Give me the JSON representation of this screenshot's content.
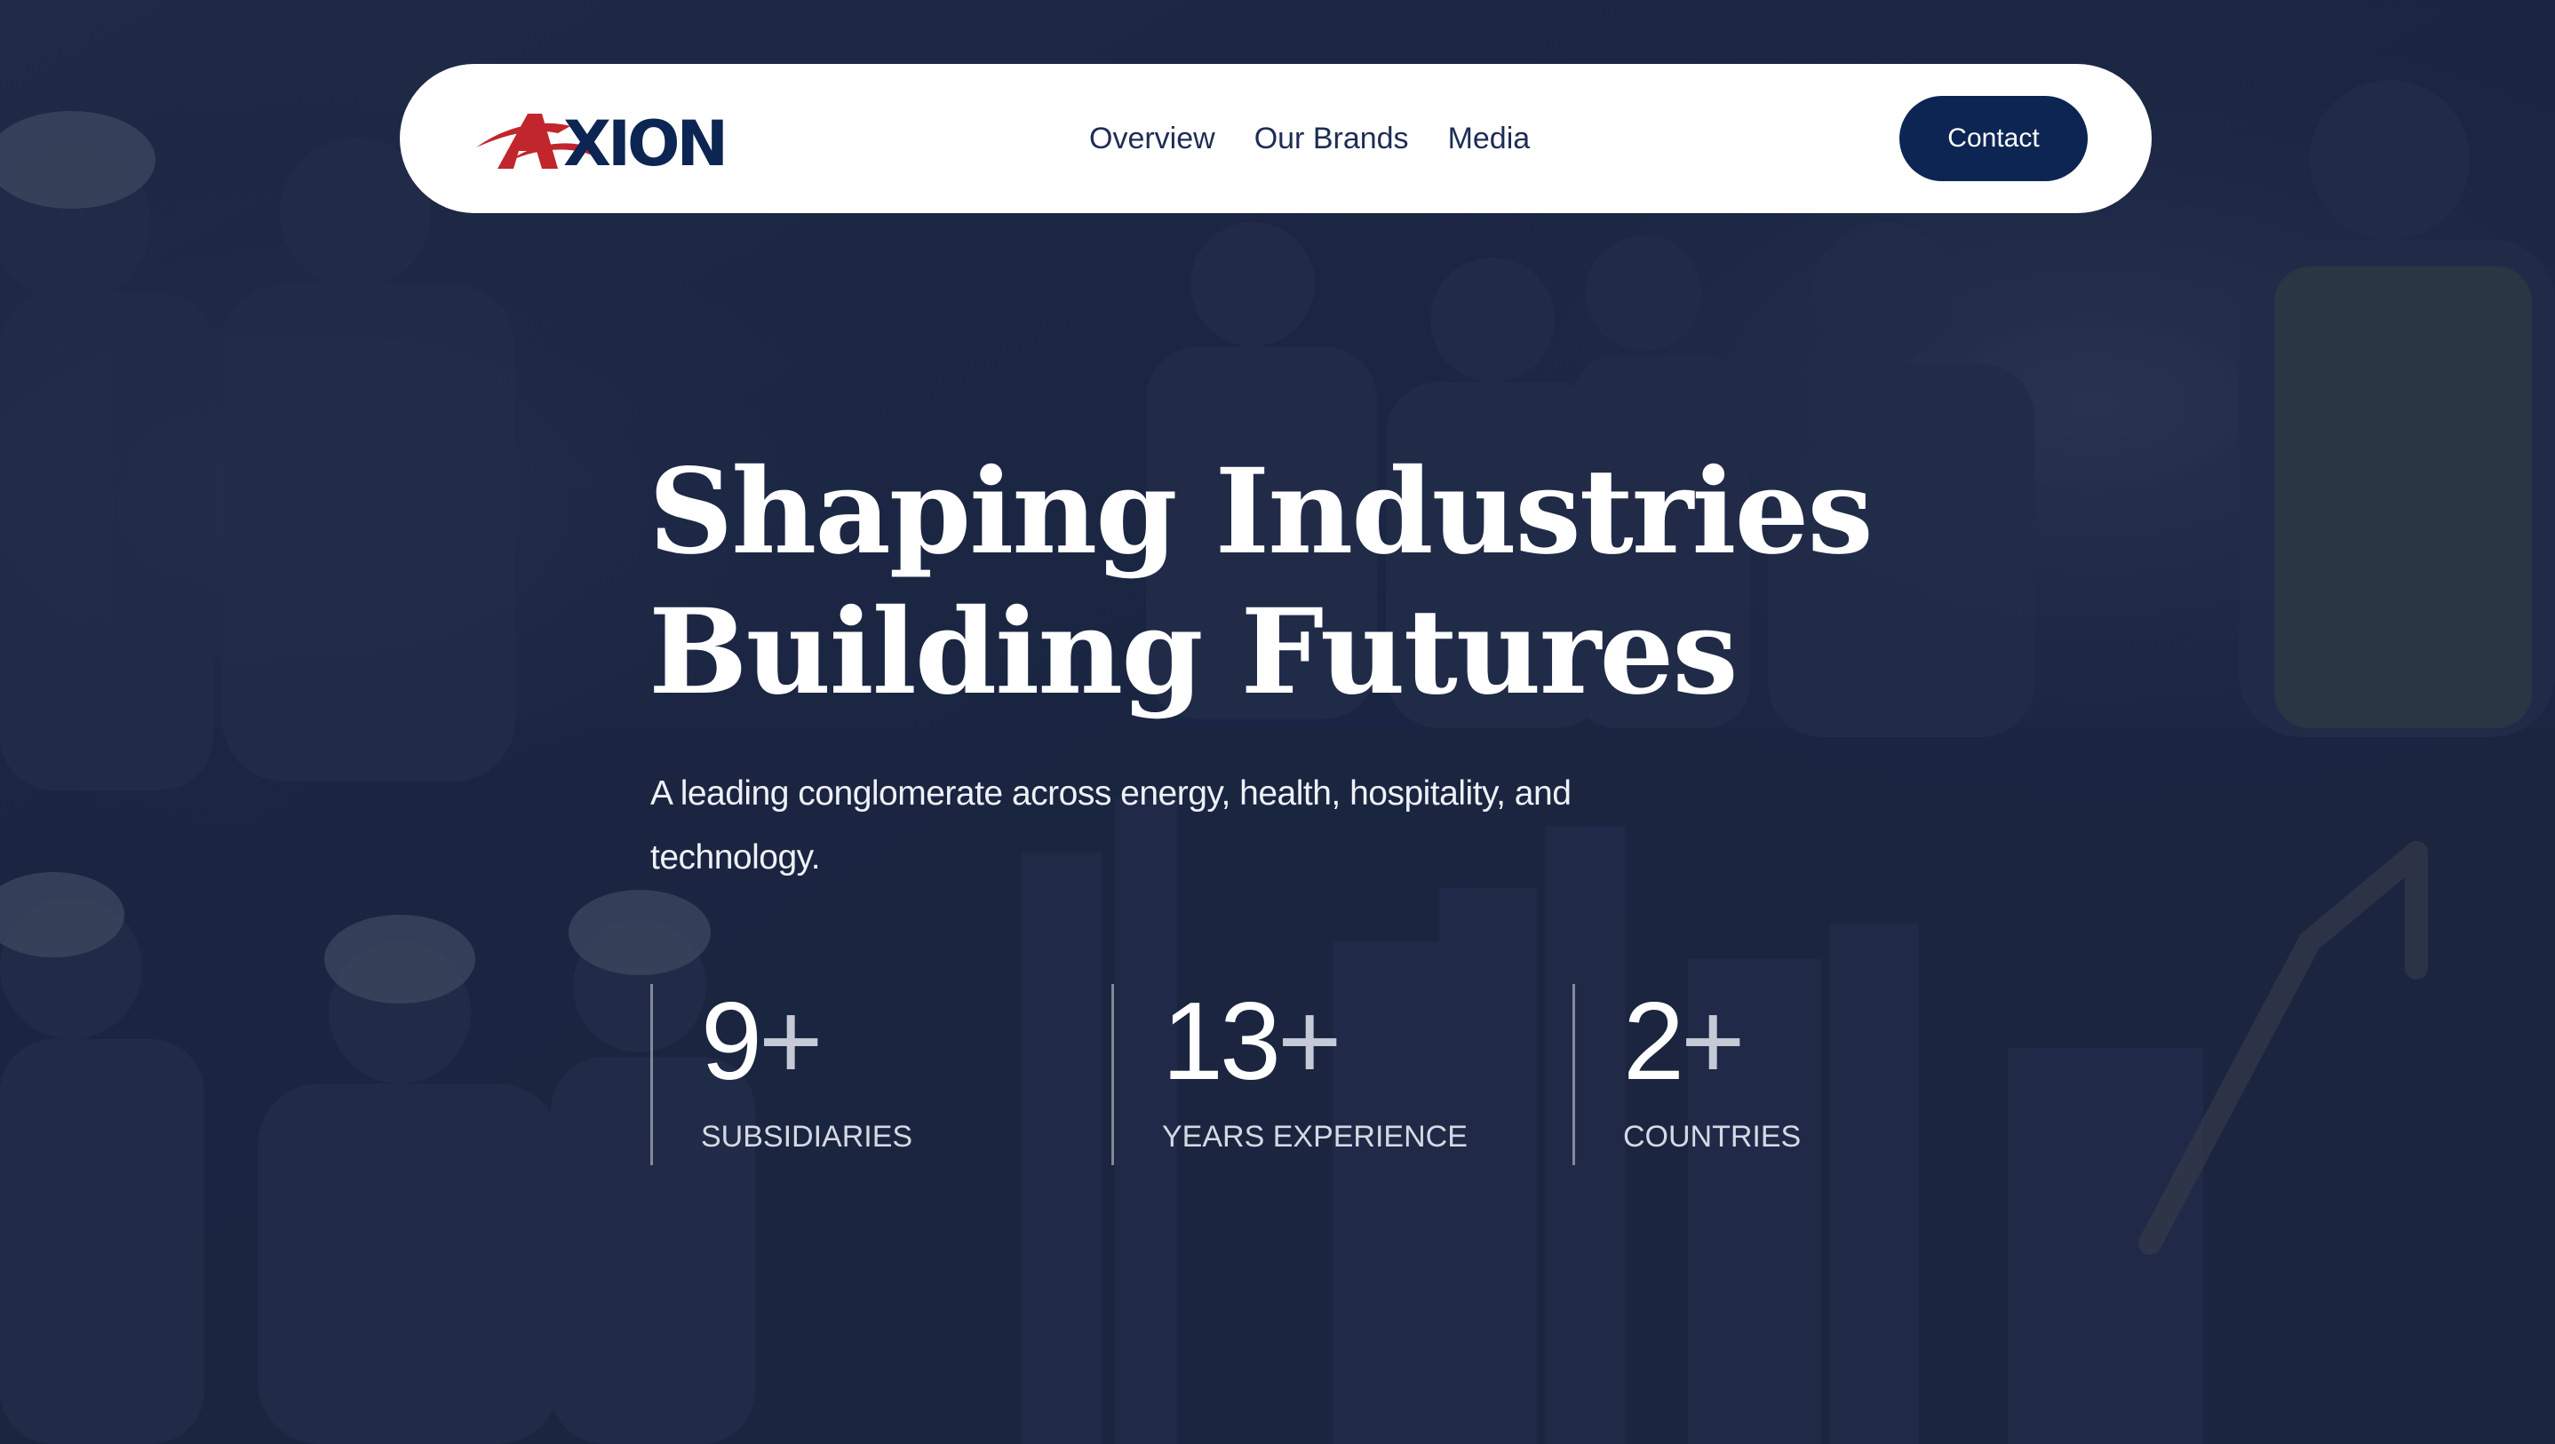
{
  "brand": {
    "logo_text": "AXION",
    "logo_color_primary": "#0c2553",
    "logo_color_accent": "#c0262c"
  },
  "nav": {
    "items": [
      {
        "label": "Overview"
      },
      {
        "label": "Our Brands"
      },
      {
        "label": "Media"
      }
    ],
    "contact_label": "Contact"
  },
  "hero": {
    "title_line1": "Shaping Industries",
    "title_line2": "Building Futures",
    "subtitle": "A leading conglomerate across energy, health, hospitality, and technology.",
    "background_tint": "#1c2744"
  },
  "stats": [
    {
      "value": "9",
      "suffix": "+",
      "label": "SUBSIDIARIES"
    },
    {
      "value": "13",
      "suffix": "+",
      "label": "YEARS EXPERIENCE"
    },
    {
      "value": "2",
      "suffix": "+",
      "label": "COUNTRIES"
    }
  ],
  "colors": {
    "navbar_bg": "#ffffff",
    "button_bg": "#0c2553",
    "nav_text": "#1e2d55"
  }
}
